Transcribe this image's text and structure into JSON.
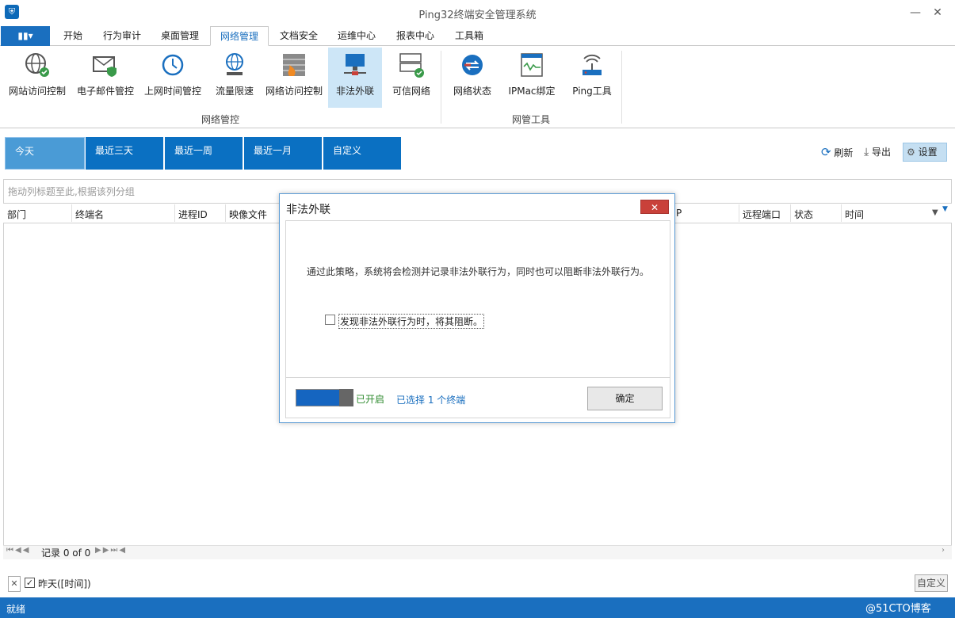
{
  "window": {
    "title": "Ping32终端安全管理系统"
  },
  "menu": {
    "tabs": [
      "开始",
      "行为审计",
      "桌面管理",
      "网络管理",
      "文档安全",
      "运维中心",
      "报表中心",
      "工具箱"
    ],
    "active": "网络管理"
  },
  "ribbon": {
    "groups": [
      {
        "label": "网络管控",
        "items": [
          "网站访问控制",
          "电子邮件管控",
          "上网时间管控",
          "流量限速",
          "网络访问控制",
          "非法外联",
          "可信网络"
        ]
      },
      {
        "label": "网管工具",
        "items": [
          "网络状态",
          "IPMac绑定",
          "Ping工具"
        ]
      }
    ],
    "selected": "非法外联"
  },
  "timefilter": {
    "options": [
      "今天",
      "最近三天",
      "最近一周",
      "最近一月",
      "自定义"
    ],
    "active": "今天"
  },
  "toolbar": {
    "refresh": "刷新",
    "export": "导出",
    "settings": "设置"
  },
  "grid": {
    "group_hint": "拖动列标题至此,根据该列分组",
    "columns": [
      "部门",
      "终端名",
      "进程ID",
      "映像文件",
      "P",
      "远程端口",
      "状态",
      "时间"
    ]
  },
  "pager": {
    "text": "记录 0 of 0"
  },
  "filter": {
    "text": "昨天([时间])",
    "custom_button": "自定义"
  },
  "status": {
    "text": "就绪",
    "watermark": "@51CTO博客"
  },
  "dialog": {
    "title": "非法外联",
    "close": "✕",
    "description": "通过此策略，系统将会检测并记录非法外联行为，同时也可以阻断非法外联行为。",
    "checkbox_label": "发现非法外联行为时，将其阻断。",
    "toggle_status": "已开启",
    "selected_text": "已选择 1 个终端",
    "ok": "确定"
  },
  "colors": {
    "accent": "#1a6fbf",
    "close": "#c9413a",
    "on": "#2d8a2d"
  }
}
